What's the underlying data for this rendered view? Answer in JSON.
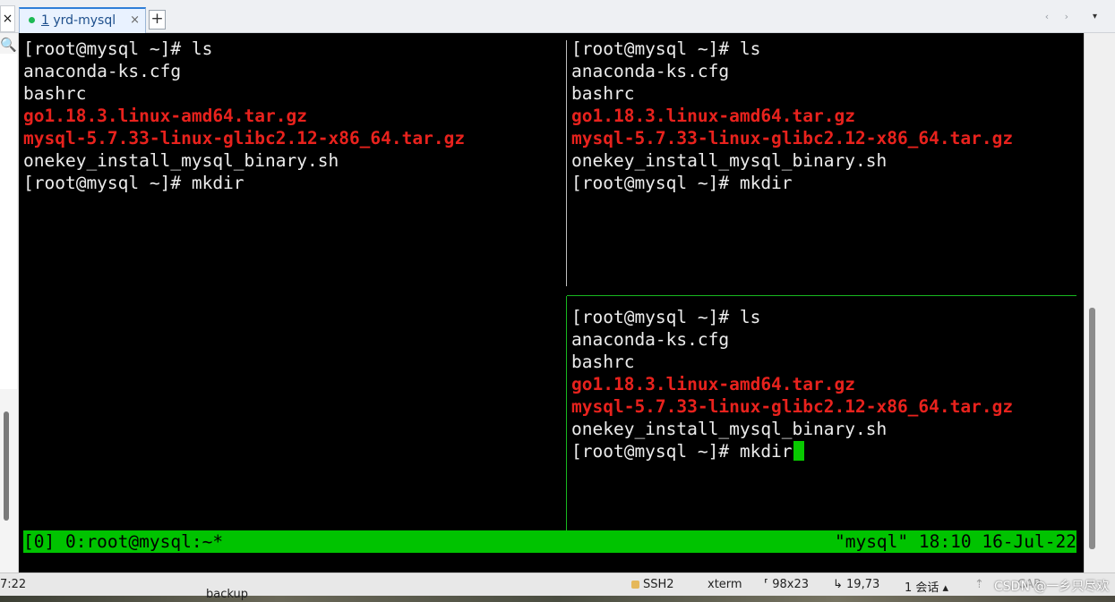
{
  "window": {
    "side_close": "×",
    "tab": {
      "number": "1",
      "title": "yrd-mysql",
      "close": "×"
    },
    "add_tab": "+",
    "nav_arrows": "‹ ›",
    "nav_menu": "▾"
  },
  "left_strip": {
    "search_icon": "🔍"
  },
  "panes": {
    "left": [
      {
        "text": "[root@mysql ~]# ls",
        "style": "normal"
      },
      {
        "text": "anaconda-ks.cfg",
        "style": "normal"
      },
      {
        "text": "bashrc",
        "style": "normal"
      },
      {
        "text": "go1.18.3.linux-amd64.tar.gz",
        "style": "red"
      },
      {
        "text": "mysql-5.7.33-linux-glibc2.12-x86_64.tar.gz",
        "style": "red"
      },
      {
        "text": "onekey_install_mysql_binary.sh",
        "style": "normal"
      },
      {
        "text": "[root@mysql ~]# mkdir",
        "style": "normal"
      }
    ],
    "top_right": [
      {
        "text": "[root@mysql ~]# ls",
        "style": "normal"
      },
      {
        "text": "anaconda-ks.cfg",
        "style": "normal"
      },
      {
        "text": "bashrc",
        "style": "normal"
      },
      {
        "text": "go1.18.3.linux-amd64.tar.gz",
        "style": "red"
      },
      {
        "text": "mysql-5.7.33-linux-glibc2.12-x86_64.tar.gz",
        "style": "red"
      },
      {
        "text": "onekey_install_mysql_binary.sh",
        "style": "normal"
      },
      {
        "text": "[root@mysql ~]# mkdir",
        "style": "normal"
      }
    ],
    "bottom_right": [
      {
        "text": "[root@mysql ~]# ls",
        "style": "normal"
      },
      {
        "text": "anaconda-ks.cfg",
        "style": "normal"
      },
      {
        "text": "bashrc",
        "style": "normal"
      },
      {
        "text": "go1.18.3.linux-amd64.tar.gz",
        "style": "red"
      },
      {
        "text": "mysql-5.7.33-linux-glibc2.12-x86_64.tar.gz",
        "style": "red"
      },
      {
        "text": "onekey_install_mysql_binary.sh",
        "style": "normal"
      },
      {
        "text": "[root@mysql ~]# mkdir",
        "style": "normal",
        "cursor": true
      }
    ]
  },
  "tmux_status": {
    "left": "[0] 0:root@mysql:~*",
    "right": "\"mysql\" 18:10 16-Jul-22"
  },
  "status_bar": {
    "left_fragment": "7:22",
    "protocol": "SSH2",
    "terminal_type": "xterm",
    "size": "98x23",
    "cursor_pos": "19,73",
    "sessions": "1 会话",
    "arrow": "⇡",
    "caps": "CAP"
  },
  "desktop": {
    "label": "backup"
  },
  "watermark": "CSDN @一乡只尽欢",
  "colors": {
    "terminal_bg": "#000000",
    "terminal_fg": "#ececec",
    "red": "#e8221d",
    "tmux_green": "#00c300",
    "cursor": "#08c900"
  }
}
